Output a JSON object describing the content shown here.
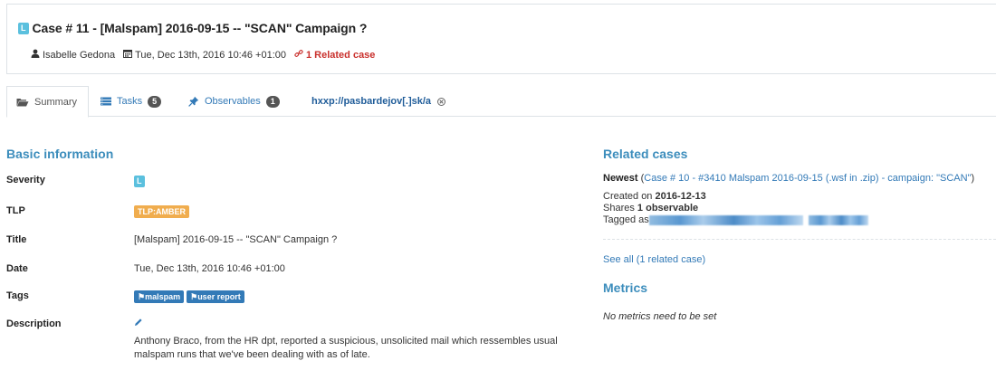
{
  "header": {
    "severity_badge": "L",
    "title": "Case # 11 - [Malspam] 2016-09-15 -- \"SCAN\" Campaign ?",
    "owner": "Isabelle Gedona",
    "date": "Tue, Dec 13th, 2016 10:46 +01:00",
    "related": "1 Related case"
  },
  "tabs": {
    "summary": "Summary",
    "tasks": "Tasks",
    "tasks_count": "5",
    "observables": "Observables",
    "observables_count": "1",
    "observable_tab": "hxxp://pasbardejov[.]sk/a"
  },
  "basic": {
    "section_title": "Basic information",
    "severity_label": "Severity",
    "severity_value": "L",
    "tlp_label": "TLP",
    "tlp_value": "TLP:AMBER",
    "title_label": "Title",
    "title_value": "[Malspam] 2016-09-15 -- \"SCAN\" Campaign ?",
    "date_label": "Date",
    "date_value": "Tue, Dec 13th, 2016 10:46 +01:00",
    "tags_label": "Tags",
    "tags": [
      "malspam",
      "user report"
    ],
    "description_label": "Description",
    "description_value": "Anthony Braco, from the HR dpt, reported a suspicious, unsolicited mail which ressembles usual malspam runs that we've been dealing with as of late."
  },
  "related": {
    "section_title": "Related cases",
    "newest_label": "Newest",
    "newest_open": " (",
    "newest_link": "Case # 10 - #3410 Malspam 2016-09-15 (.wsf in .zip) - campaign: \"SCAN\"",
    "newest_close": ")",
    "created_prefix": "Created on ",
    "created_date": "2016-12-13",
    "shares_prefix": "Shares ",
    "shares_value": "1 observable",
    "tagged_prefix": "Tagged as",
    "see_all": "See all (1 related case)"
  },
  "metrics": {
    "section_title": "Metrics",
    "empty_text": "No metrics need to be set"
  },
  "colors": {
    "accent": "#3c8dbc",
    "link": "#337ab7",
    "severity_low": "#5bc0de",
    "tlp_amber": "#f0ad4e",
    "danger": "#c9302c"
  },
  "icons": [
    "user-icon",
    "calendar-icon",
    "link-icon",
    "folder-open-icon",
    "tasks-icon",
    "pin-icon",
    "close-circle-icon",
    "tag-icon",
    "pencil-icon"
  ]
}
